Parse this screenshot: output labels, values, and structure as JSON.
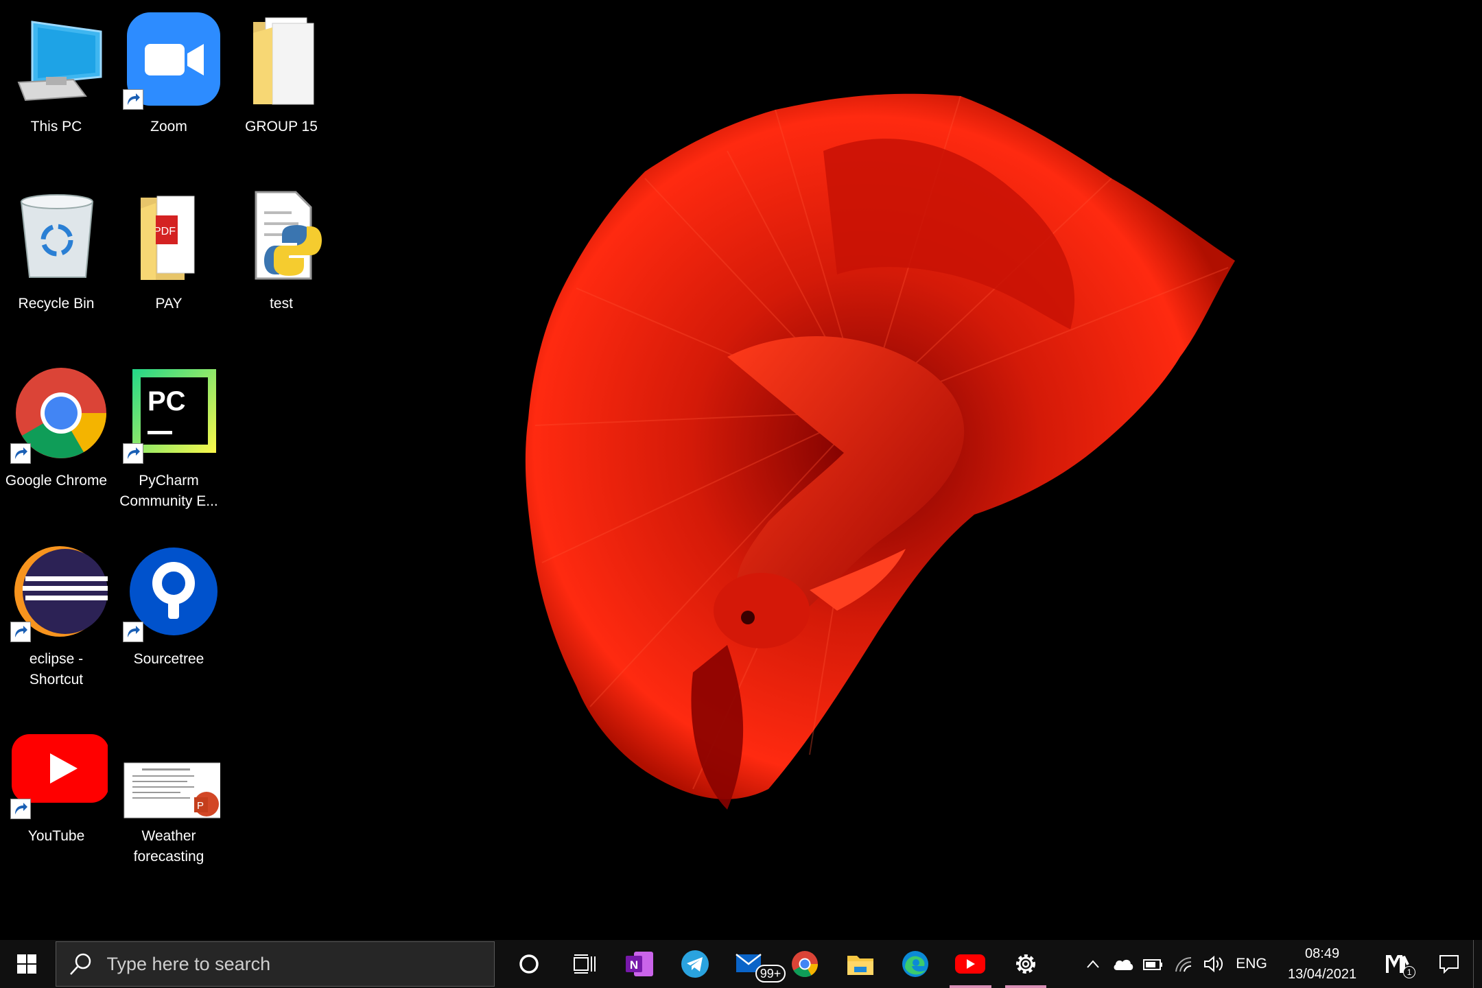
{
  "desktop": {
    "icons": [
      {
        "label": "This PC",
        "icon": "this-pc-icon",
        "shortcut": false
      },
      {
        "label": "Zoom",
        "icon": "zoom-icon",
        "shortcut": true
      },
      {
        "label": "GROUP 15",
        "icon": "folder-icon",
        "shortcut": false
      },
      {
        "label": "Recycle Bin",
        "icon": "recycle-bin-icon",
        "shortcut": false
      },
      {
        "label": "PAY",
        "icon": "pdf-folder-icon",
        "shortcut": false
      },
      {
        "label": "test",
        "icon": "python-file-icon",
        "shortcut": false
      },
      {
        "label": "Google Chrome",
        "icon": "chrome-icon",
        "shortcut": true
      },
      {
        "label": "PyCharm\nCommunity E...",
        "icon": "pycharm-icon",
        "shortcut": true
      },
      {
        "label": "eclipse -\nShortcut",
        "icon": "eclipse-icon",
        "shortcut": true
      },
      {
        "label": "Sourcetree",
        "icon": "sourcetree-icon",
        "shortcut": true
      },
      {
        "label": "YouTube",
        "icon": "youtube-icon",
        "shortcut": true
      },
      {
        "label": "Weather\nforecasting",
        "icon": "powerpoint-file-icon",
        "shortcut": false
      }
    ],
    "wallpaper": "red-betta-fish"
  },
  "taskbar": {
    "search_placeholder": "Type here to search",
    "mail_badge": "99+",
    "apps": [
      "onenote-icon",
      "telegram-icon",
      "mail-icon",
      "chrome-icon",
      "file-explorer-icon",
      "edge-icon",
      "youtube-icon",
      "settings-icon"
    ],
    "language": "ENG",
    "time": "08:49",
    "date": "13/04/2021",
    "notification_count": "1"
  },
  "colors": {
    "taskbar_bg": "#101010",
    "search_bg": "#262626",
    "active_indicator": "#d98fb5",
    "fish_red": "#e01a0a"
  }
}
